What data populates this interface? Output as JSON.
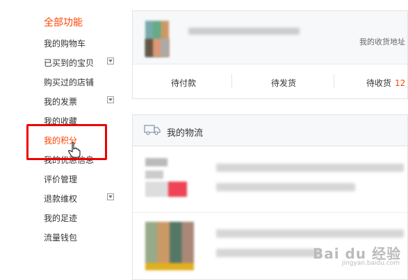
{
  "sidebar": {
    "title": "全部功能",
    "items": [
      {
        "label": "我的购物车",
        "dropdown": false
      },
      {
        "label": "已买到的宝贝",
        "dropdown": true
      },
      {
        "label": "购买过的店铺",
        "dropdown": false
      },
      {
        "label": "我的发票",
        "dropdown": true
      },
      {
        "label": "我的收藏",
        "dropdown": false
      },
      {
        "label": "我的积分",
        "dropdown": false,
        "active": true
      },
      {
        "label": "我的优惠信息",
        "dropdown": false
      },
      {
        "label": "评价管理",
        "dropdown": false
      },
      {
        "label": "退款维权",
        "dropdown": true
      },
      {
        "label": "我的足迹",
        "dropdown": false
      },
      {
        "label": "流量钱包",
        "dropdown": false
      }
    ]
  },
  "profile": {
    "address_link": "我的收货地址"
  },
  "order_status": [
    {
      "label": "待付款",
      "count": ""
    },
    {
      "label": "待发货",
      "count": ""
    },
    {
      "label": "待收货",
      "count": "12"
    }
  ],
  "logistics": {
    "title": "我的物流"
  },
  "watermark": {
    "brand": "Bai du 经验",
    "url": "jingyan.baidu.com"
  },
  "colors": {
    "accent": "#ff4400",
    "highlight": "#ee0000"
  }
}
